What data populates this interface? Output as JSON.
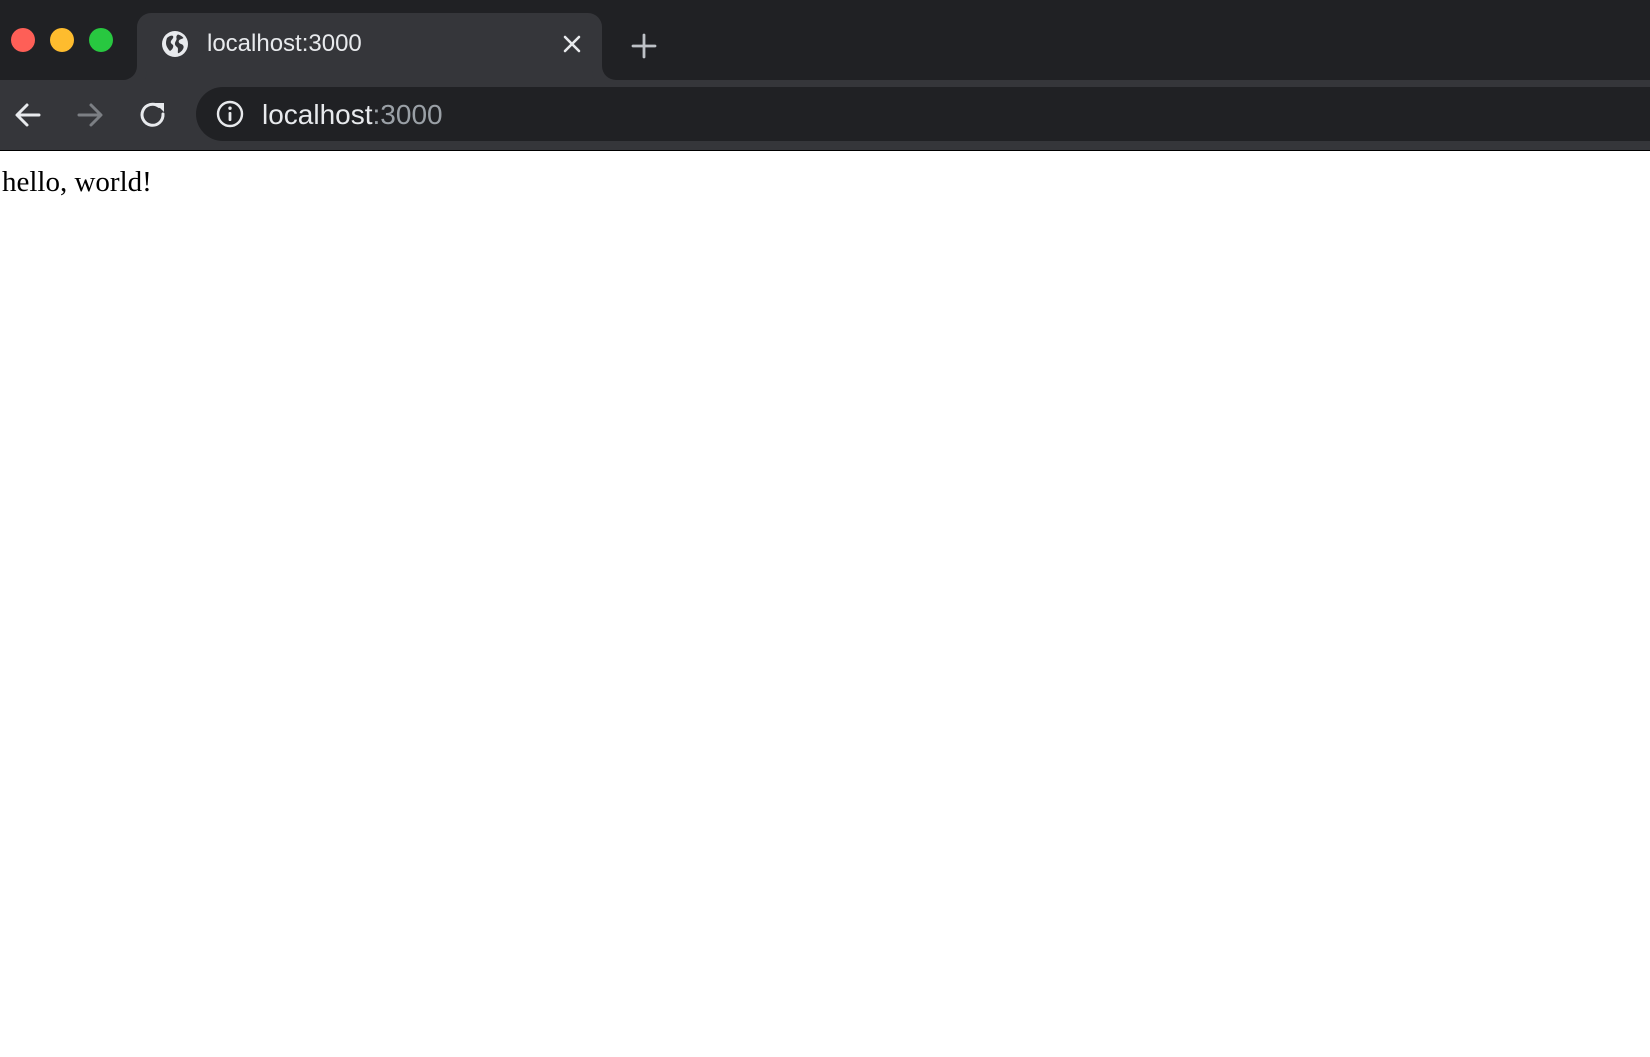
{
  "window": {
    "controls": {
      "close_color": "#fe5f57",
      "minimize_color": "#febc2e",
      "maximize_color": "#28c840"
    }
  },
  "tab": {
    "title": "localhost:3000",
    "favicon": "globe-icon",
    "close_icon": "close-icon"
  },
  "new_tab": {
    "icon": "plus-icon"
  },
  "toolbar": {
    "back_icon": "arrow-left-icon",
    "forward_icon": "arrow-right-icon",
    "reload_icon": "reload-icon",
    "forward_enabled": false
  },
  "address_bar": {
    "icon": "info-icon",
    "host": "localhost",
    "port": ":3000"
  },
  "page": {
    "body_text": "hello, world!"
  },
  "colors": {
    "tabstrip_bg": "#202124",
    "active_tab_bg": "#35363a",
    "omnibox_bg": "#202124",
    "text_primary": "#e8eaed",
    "text_secondary": "#9aa0a6"
  }
}
